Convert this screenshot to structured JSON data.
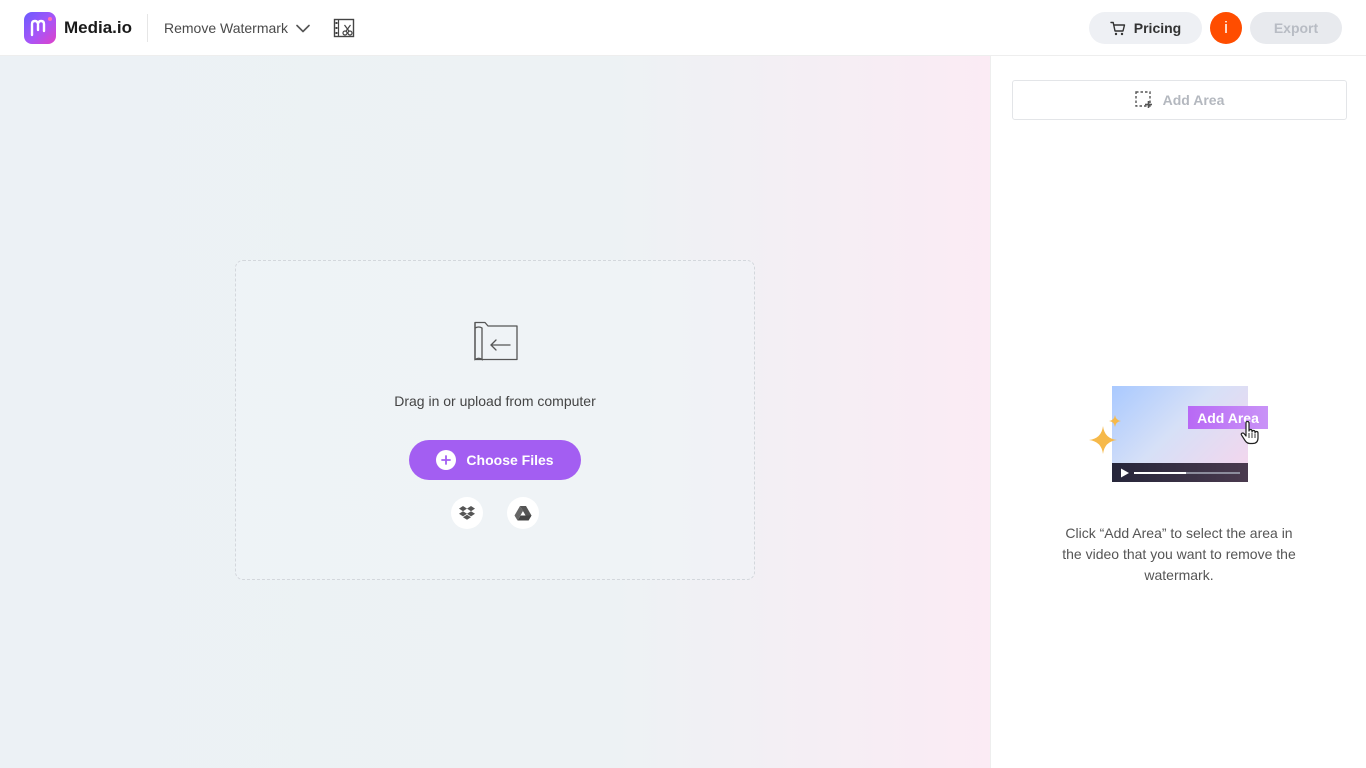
{
  "header": {
    "brand": "Media.io",
    "tool_selector_label": "Remove Watermark",
    "pricing_label": "Pricing",
    "avatar_initial": "i",
    "export_label": "Export"
  },
  "upload": {
    "prompt": "Drag in or upload from computer",
    "choose_files_label": "Choose Files",
    "cloud_sources": [
      "dropbox-icon",
      "google-drive-icon"
    ]
  },
  "panel": {
    "add_area_label": "Add Area",
    "illustration_tag": "Add Area",
    "instructions": "Click “Add Area” to select the area in the video that you want to remove the watermark."
  },
  "colors": {
    "accent": "#a35ef2",
    "avatar": "#ff4d00",
    "star": "#f6b94a"
  }
}
